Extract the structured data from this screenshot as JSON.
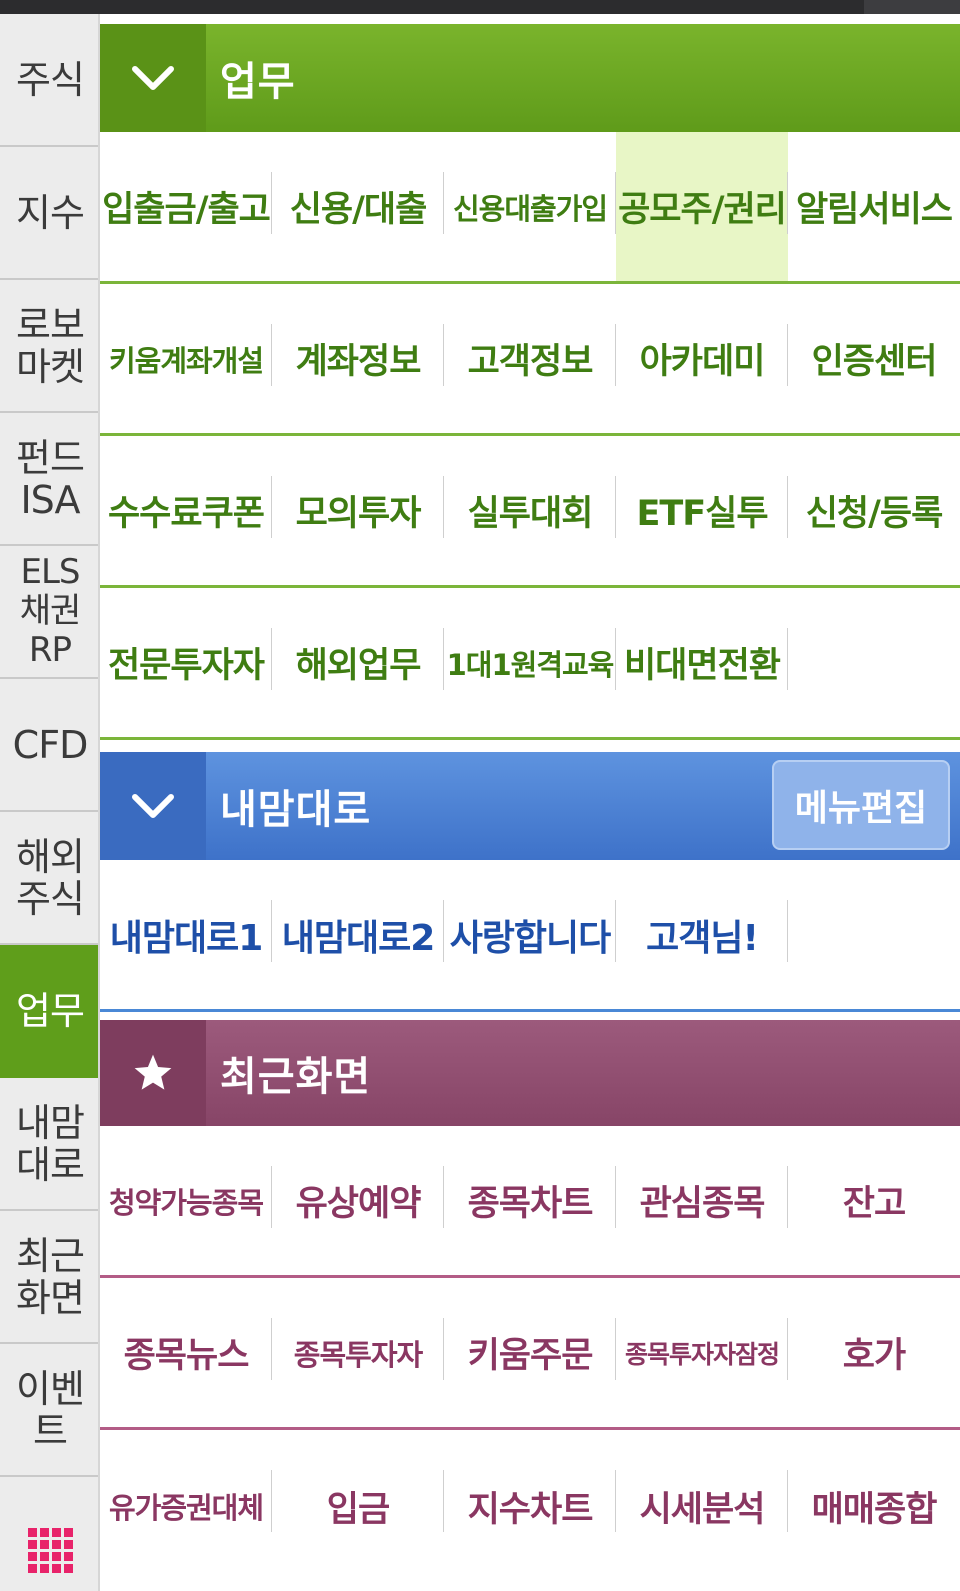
{
  "sidebar": {
    "items": [
      {
        "label": "주식"
      },
      {
        "label": "지수"
      },
      {
        "label": "로보\n마켓"
      },
      {
        "label": "펀드\nISA"
      },
      {
        "label": "ELS\n채권\nRP"
      },
      {
        "label": "CFD"
      },
      {
        "label": "해외\n주식"
      },
      {
        "label": "업무"
      },
      {
        "label": "내맘\n대로"
      },
      {
        "label": "최근\n화면"
      },
      {
        "label": "이벤트"
      }
    ],
    "active": "업무",
    "grid_icon": "grid-icon"
  },
  "sections": {
    "work": {
      "title": "업무",
      "icon": "chevron-down-icon",
      "color": "#6fa823",
      "rows": [
        [
          "입출금/출고",
          "신용/대출",
          "신용대출가입",
          "공모주/권리",
          "알림서비스"
        ],
        [
          "키움계좌개설",
          "계좌정보",
          "고객정보",
          "아카데미",
          "인증센터"
        ],
        [
          "수수료쿠폰",
          "모의투자",
          "실투대회",
          "ETF실투",
          "신청/등록"
        ],
        [
          "전문투자자",
          "해외업무",
          "1대1원격교육",
          "비대면전환",
          ""
        ]
      ],
      "highlighted": "공모주/권리"
    },
    "custom": {
      "title": "내맘대로",
      "icon": "chevron-down-icon",
      "color": "#4f86d6",
      "edit_label": "메뉴편집",
      "rows": [
        [
          "내맘대로1",
          "내맘대로2",
          "사랑합니다",
          "고객님!",
          ""
        ]
      ]
    },
    "recent": {
      "title": "최근화면",
      "icon": "star-icon",
      "color": "#93506f",
      "rows": [
        [
          "청약가능종목",
          "유상예약",
          "종목차트",
          "관심종목",
          "잔고"
        ],
        [
          "종목뉴스",
          "종목투자자",
          "키움주문",
          "종목투자자잠정",
          "호가"
        ],
        [
          "유가증권대체",
          "입금",
          "지수차트",
          "시세분석",
          "매매종합"
        ]
      ]
    }
  }
}
